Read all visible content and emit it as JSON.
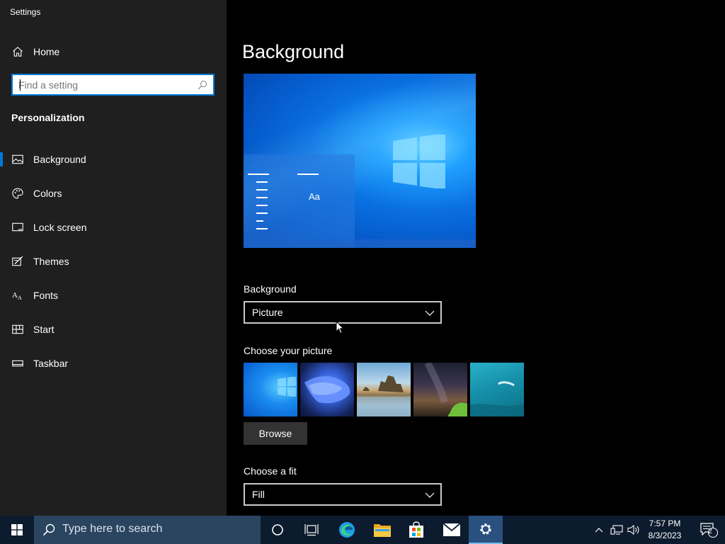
{
  "window": {
    "title": "Settings"
  },
  "sidebar": {
    "home_label": "Home",
    "search_placeholder": "Find a setting",
    "section_title": "Personalization",
    "items": [
      {
        "label": "Background",
        "icon": "image-icon",
        "active": true
      },
      {
        "label": "Colors",
        "icon": "palette-icon",
        "active": false
      },
      {
        "label": "Lock screen",
        "icon": "lock-screen-icon",
        "active": false
      },
      {
        "label": "Themes",
        "icon": "themes-icon",
        "active": false
      },
      {
        "label": "Fonts",
        "icon": "fonts-icon",
        "active": false
      },
      {
        "label": "Start",
        "icon": "start-icon",
        "active": false
      },
      {
        "label": "Taskbar",
        "icon": "taskbar-icon",
        "active": false
      }
    ]
  },
  "main": {
    "title": "Background",
    "preview": {
      "sample_text": "Aa"
    },
    "background_field": {
      "label": "Background",
      "value": "Picture"
    },
    "picture_field": {
      "label": "Choose your picture",
      "browse_label": "Browse"
    },
    "fit_field": {
      "label": "Choose a fit",
      "value": "Fill"
    }
  },
  "taskbar": {
    "search_placeholder": "Type here to search",
    "time": "7:57 PM",
    "date": "8/3/2023",
    "notification_count": "2"
  },
  "colors": {
    "accent": "#0078d7",
    "sidebar_bg": "#1f1f1f",
    "content_bg": "#000000",
    "taskbar_bg": "#0d1b2e"
  }
}
